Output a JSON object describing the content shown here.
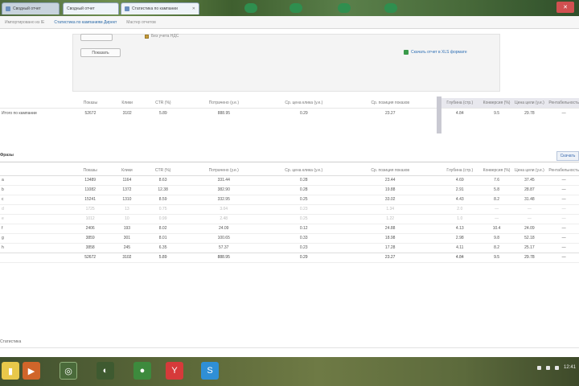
{
  "browser": {
    "tabs": [
      {
        "label": "Сводный отчет",
        "active": false
      },
      {
        "label": "Статистика по кампании",
        "active": true
      }
    ],
    "bookmarks": [
      "Импортировано из IE",
      "Статистика по кампаниям Директ",
      "Мастер отчетов"
    ],
    "close_glyph": "✕"
  },
  "filter": {
    "checkbox_label": "Без учета НДС",
    "show_button": "Показать",
    "export_link": "Скачать отчет в XLS формате"
  },
  "columns": [
    "Показы",
    "Клики",
    "CTR (%)",
    "Потрачено (у.е.)",
    "Ср. цена клика (у.е.)",
    "Ср. позиция показов",
    "Глубина (стр.)",
    "Конверсия (%)",
    "Цена цели (у.е.)",
    "Рентабельность"
  ],
  "summary": {
    "row_label": "Итого по кампании",
    "values": [
      "52672",
      "3102",
      "5.89",
      "888.95",
      "0.29",
      "23.27",
      "4.84",
      "9.5",
      "29.78",
      "—"
    ]
  },
  "section": {
    "title": "Фразы",
    "action": "Скачать"
  },
  "detail_rows": [
    {
      "label": "a",
      "values": [
        "13489",
        "1164",
        "8.63",
        "331.44",
        "0.28",
        "23.44",
        "4.69",
        "7.6",
        "37.45",
        "—"
      ],
      "muted": false
    },
    {
      "label": "b",
      "values": [
        "11082",
        "1372",
        "12.38",
        "382.90",
        "0.28",
        "19.88",
        "2.91",
        "5.8",
        "28.87",
        "—"
      ],
      "muted": false
    },
    {
      "label": "c",
      "values": [
        "15241",
        "1310",
        "8.59",
        "332.95",
        "0.25",
        "33.02",
        "4.43",
        "8.2",
        "31.48",
        "—"
      ],
      "muted": false
    },
    {
      "label": "d",
      "values": [
        "1725",
        "13",
        "0.75",
        "3.04",
        "0.23",
        "1.34",
        "2.0",
        "—",
        "—",
        "—"
      ],
      "muted": true
    },
    {
      "label": "e",
      "values": [
        "1012",
        "10",
        "0.99",
        "2.48",
        "0.25",
        "1.22",
        "1.0",
        "—",
        "—",
        "—"
      ],
      "muted": true
    },
    {
      "label": "f",
      "values": [
        "2406",
        "193",
        "8.02",
        "24.09",
        "0.12",
        "24.88",
        "4.13",
        "10.4",
        "24.09",
        "—"
      ],
      "muted": false
    },
    {
      "label": "g",
      "values": [
        "3859",
        "301",
        "8.01",
        "100.65",
        "0.33",
        "18.98",
        "2.98",
        "9.8",
        "52.18",
        "—"
      ],
      "muted": false
    },
    {
      "label": "h",
      "values": [
        "3858",
        "245",
        "6.35",
        "57.37",
        "0.23",
        "17.28",
        "4.11",
        "8.2",
        "25.17",
        "—"
      ],
      "muted": false
    }
  ],
  "total_row": {
    "label": "",
    "values": [
      "52672",
      "3102",
      "5.89",
      "888.95",
      "0.29",
      "23.27",
      "4.84",
      "9.5",
      "29.78",
      "—"
    ]
  },
  "footer": {
    "label": "Статистика"
  },
  "taskbar": {
    "icons": [
      "explorer-icon",
      "media-player-icon",
      "chrome-icon",
      "firefox-icon",
      "yandex-icon",
      "skype-icon"
    ],
    "tray_time": "12:41"
  }
}
